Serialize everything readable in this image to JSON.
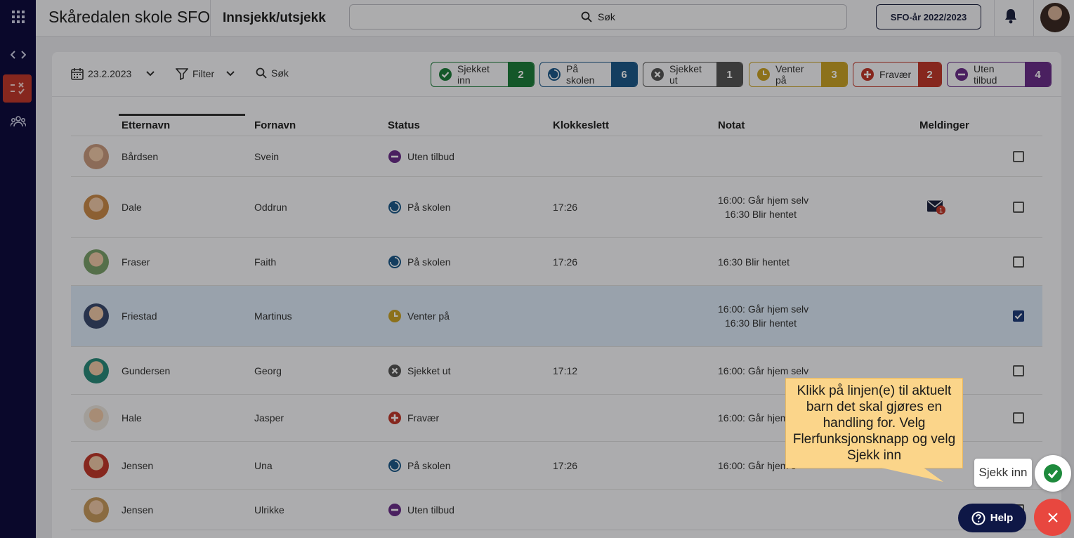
{
  "app": {
    "school_name": "Skåredalen skole SFO",
    "page_title": "Innsjekk/utsjekk",
    "search_label": "Søk",
    "year_button": "SFO-år 2022/2023"
  },
  "toolbar": {
    "date": "23.2.2023",
    "filter_label": "Filter",
    "search_label": "Søk"
  },
  "status_chips": [
    {
      "label": "Sjekket inn",
      "count": "2",
      "color": "#1e7d3c",
      "icon": "check-circle-icon"
    },
    {
      "label": "På skolen",
      "count": "6",
      "color": "#1d5a8a",
      "icon": "pie-icon"
    },
    {
      "label": "Sjekket ut",
      "count": "1",
      "color": "#555555",
      "icon": "x-circle-icon"
    },
    {
      "label": "Venter på",
      "count": "3",
      "color": "#c9a227",
      "icon": "clock-icon"
    },
    {
      "label": "Fravær",
      "count": "2",
      "color": "#c0392b",
      "icon": "plus-circle-icon"
    },
    {
      "label": "Uten tilbud",
      "count": "4",
      "color": "#6a2e8a",
      "icon": "minus-circle-icon"
    }
  ],
  "table": {
    "headers": {
      "last_name": "Etternavn",
      "first_name": "Fornavn",
      "status": "Status",
      "time": "Klokkeslett",
      "note": "Notat",
      "messages": "Meldinger"
    },
    "rows": [
      {
        "last": "Bårdsen",
        "first": "Svein",
        "status": "Uten tilbud",
        "status_key": "uten",
        "time": "",
        "note1": "",
        "note2": "",
        "mail": false,
        "mail_count": "",
        "checked": false
      },
      {
        "last": "Dale",
        "first": "Oddrun",
        "status": "På skolen",
        "status_key": "skolen",
        "time": "17:26",
        "note1": "16:00: Går hjem selv",
        "note2": "16:30 Blir hentet",
        "mail": true,
        "mail_count": "1",
        "checked": false
      },
      {
        "last": "Fraser",
        "first": "Faith",
        "status": "På skolen",
        "status_key": "skolen",
        "time": "17:26",
        "note1": "16:30 Blir hentet",
        "note2": "",
        "mail": false,
        "mail_count": "",
        "checked": false
      },
      {
        "last": "Friestad",
        "first": "Martinus",
        "status": "Venter på",
        "status_key": "venter",
        "time": "",
        "note1": "16:00: Går hjem selv",
        "note2": "16:30 Blir hentet",
        "mail": false,
        "mail_count": "",
        "checked": true
      },
      {
        "last": "Gundersen",
        "first": "Georg",
        "status": "Sjekket ut",
        "status_key": "ut",
        "time": "17:12",
        "note1": "16:00: Går hjem selv",
        "note2": "",
        "mail": false,
        "mail_count": "",
        "checked": false
      },
      {
        "last": "Hale",
        "first": "Jasper",
        "status": "Fravær",
        "status_key": "fravaer",
        "time": "",
        "note1": "16:00: Går hjem s",
        "note2": "",
        "mail": false,
        "mail_count": "",
        "checked": false
      },
      {
        "last": "Jensen",
        "first": "Una",
        "status": "På skolen",
        "status_key": "skolen",
        "time": "17:26",
        "note1": "16:00: Går hjem s",
        "note2": "",
        "mail": false,
        "mail_count": "",
        "checked": false
      },
      {
        "last": "Jensen",
        "first": "Ulrikke",
        "status": "Uten tilbud",
        "status_key": "uten",
        "time": "",
        "note1": "",
        "note2": "",
        "mail": false,
        "mail_count": "",
        "checked": false
      }
    ]
  },
  "tutorial": {
    "tooltip": "Klikk på linjen(e) til aktuelt barn det skal gjøres en handling for. Velg Flerfunksjonsknapp og velg Sjekk inn",
    "action_label": "Sjekk inn"
  },
  "help": {
    "label": "Help"
  }
}
